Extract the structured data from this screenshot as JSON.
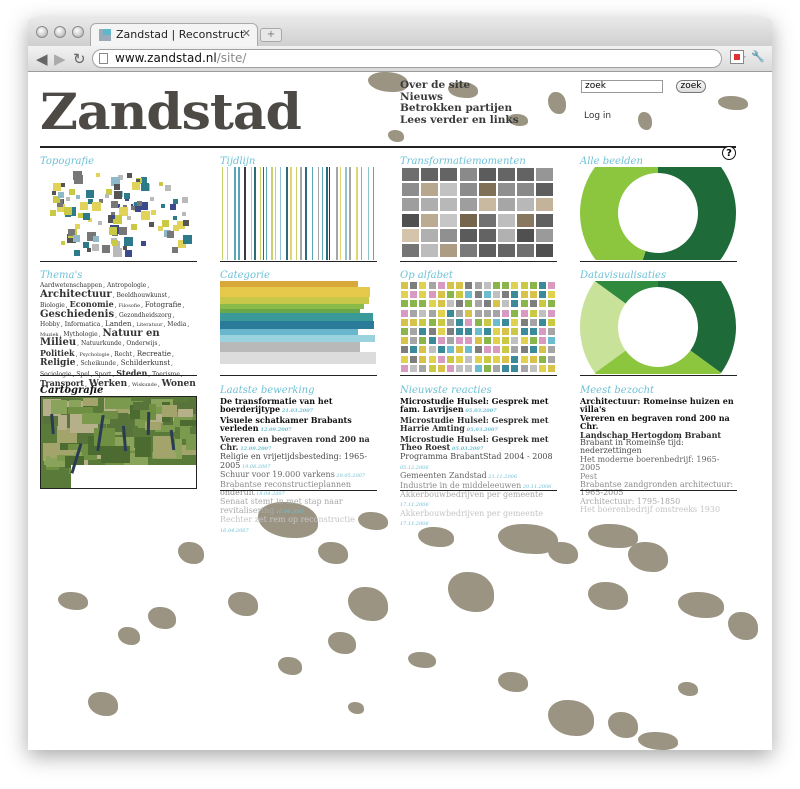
{
  "browser": {
    "tab_title": "Zandstad | Reconstructie va",
    "url_host": "www.zandstad.nl",
    "url_path": "/site/",
    "close_glyph": "✕",
    "newtab_glyph": "+",
    "back_glyph": "◀",
    "forward_glyph": "▶",
    "reload_glyph": "↻",
    "star_glyph": "☆",
    "wrench_glyph": "🔧"
  },
  "site": {
    "logo": "Zandstad",
    "nav": [
      "Over de site",
      "Nieuws",
      "Betrokken partijen",
      "Lees verder en links"
    ],
    "search_value": "zoek",
    "search_button": "zoek",
    "login": "Log in",
    "help": "?"
  },
  "panels": {
    "topografie": "Topografie",
    "tijdlijn": "Tijdlijn",
    "transformatiemomenten": "Transformatiemomenten",
    "alle_beelden": "Alle beelden",
    "themas": "Thema's",
    "categorie": "Categorie",
    "op_alfabet": "Op alfabet",
    "datavisualisaties": "Datavisualisaties",
    "cartografie": "Cartografie",
    "laatste_bewerking": "Laatste bewerking",
    "nieuwste_reacties": "Nieuwste reacties",
    "meest_bezocht": "Meest bezocht"
  },
  "themes": [
    {
      "t": "Aardwetenschappen",
      "s": 6
    },
    {
      "t": "Antropologie",
      "s": 6
    },
    {
      "t": "Architectuur",
      "s": 10
    },
    {
      "t": "Beeldhouwkunst",
      "s": 6
    },
    {
      "t": "Biologie",
      "s": 6
    },
    {
      "t": "Economie",
      "s": 8
    },
    {
      "t": "Filosofie",
      "s": 5
    },
    {
      "t": "Fotografie",
      "s": 7
    },
    {
      "t": "Geschiedenis",
      "s": 10
    },
    {
      "t": "Gezondheidszorg",
      "s": 6
    },
    {
      "t": "Hobby",
      "s": 6
    },
    {
      "t": "Informatica",
      "s": 6
    },
    {
      "t": "Landen",
      "s": 7
    },
    {
      "t": "Literatuur",
      "s": 5
    },
    {
      "t": "Media",
      "s": 6
    },
    {
      "t": "Muziek",
      "s": 5
    },
    {
      "t": "Mythologie",
      "s": 6
    },
    {
      "t": "Natuur en Milieu",
      "s": 10
    },
    {
      "t": "Natuurkunde",
      "s": 6
    },
    {
      "t": "Onderwijs",
      "s": 6
    },
    {
      "t": "Politiek",
      "s": 8
    },
    {
      "t": "Psychologie",
      "s": 5
    },
    {
      "t": "Recht",
      "s": 6
    },
    {
      "t": "Recreatie",
      "s": 7
    },
    {
      "t": "Religie",
      "s": 9
    },
    {
      "t": "Scheikunde",
      "s": 6
    },
    {
      "t": "Schilderkunst",
      "s": 7
    },
    {
      "t": "Sociologie",
      "s": 6
    },
    {
      "t": "Spel",
      "s": 6
    },
    {
      "t": "Sport",
      "s": 6
    },
    {
      "t": "Steden",
      "s": 8
    },
    {
      "t": "Toerisme",
      "s": 6
    },
    {
      "t": "Transport",
      "s": 8
    },
    {
      "t": "Werken",
      "s": 9
    },
    {
      "t": "Wiskunde",
      "s": 5
    },
    {
      "t": "Wonen",
      "s": 9
    }
  ],
  "laatste_bewerking": [
    {
      "title": "De transformatie van het boerderijtype",
      "date": "21.03.2007",
      "shade": 0
    },
    {
      "title": "Visuele schatkamer Brabants verleden",
      "date": "12.09.2007",
      "shade": 0
    },
    {
      "title": "Vereren en begraven rond 200 na Chr.",
      "date": "12.09.2007",
      "shade": 1
    },
    {
      "title": "Religie en vrijetijdsbesteding: 1965-2005",
      "date": "19.06.2007",
      "shade": 2
    },
    {
      "title": "Schuur voor 19.000 varkens",
      "date": "29.05.2007",
      "shade": 3
    },
    {
      "title": "Brabantse reconstructieplannen onderuit",
      "date": "18.04.2007",
      "shade": 4
    },
    {
      "title": "Senaat stemt in met stap naar revitalisering",
      "date": "16.04.2007",
      "shade": 5
    },
    {
      "title": "Rechter zet rem op reconstructie",
      "date": "16.04.2007",
      "shade": 6
    }
  ],
  "nieuwste_reacties": [
    {
      "title": "Microstudie Hulsel: Gesprek met fam. Lavrijsen",
      "date": "05.03.2007",
      "shade": 0
    },
    {
      "title": "Microstudie Hulsel: Gesprek met Harrie Amting",
      "date": "05.03.2007",
      "shade": 1
    },
    {
      "title": "Microstudie Hulsel: Gesprek met Theo Roest",
      "date": "05.03.2007",
      "shade": 1
    },
    {
      "title": "Programma BrabantStad 2004 - 2008",
      "date": "05.12.2006",
      "shade": 2
    },
    {
      "title": "Gemeenten Zandstad",
      "date": "21.11.2006",
      "shade": 3
    },
    {
      "title": "Industrie in de middeleeuwen",
      "date": "20.11.2006",
      "shade": 4
    },
    {
      "title": "Akkerbouwbedrijven per gemeente",
      "date": "17.11.2006",
      "shade": 5
    },
    {
      "title": "Akkerbouwbedrijven per gemeente",
      "date": "17.11.2006",
      "shade": 6
    }
  ],
  "meest_bezocht": [
    {
      "title": "Architectuur: Romeinse huizen en villa's",
      "shade": 0
    },
    {
      "title": "Vereren en begraven rond 200 na Chr.",
      "shade": 0
    },
    {
      "title": "Landschap Hertogdom Brabant",
      "shade": 1
    },
    {
      "title": "Brabant in Romeinse tijd: nederzettingen",
      "shade": 2
    },
    {
      "title": "Het moderne boerenbedrijf: 1965-2005",
      "shade": 3
    },
    {
      "title": "Pest",
      "shade": 4
    },
    {
      "title": "Brabantse zandgronden architectuur: 1965-2005",
      "shade": 4
    },
    {
      "title": "Architectuur: 1795-1850",
      "shade": 5
    },
    {
      "title": "Het boerenbedrijf omstreeks 1930",
      "shade": 6
    }
  ],
  "colors": {
    "accent": "#6ec1d6",
    "blob": "#9b9482",
    "shades": [
      "#111111",
      "#2f2f2f",
      "#4a4a4a",
      "#666666",
      "#8a8a8a",
      "#a9a9a9",
      "#c4c4c4"
    ],
    "donut1": [
      "#1e6a38",
      "#8cc63f"
    ],
    "donut2": [
      "#1e6a38",
      "#8cc63f",
      "#c8e29a"
    ]
  },
  "chart_data": [
    {
      "type": "pie",
      "name": "Alle beelden",
      "values": [
        55,
        45
      ],
      "colors": [
        "#1e6a38",
        "#8cc63f"
      ]
    },
    {
      "type": "pie",
      "name": "Datavisualisaties",
      "values": [
        35,
        30,
        20,
        15
      ],
      "colors": [
        "#1e6a38",
        "#8cc63f",
        "#c8e29a",
        "#2f8a3e"
      ]
    }
  ]
}
